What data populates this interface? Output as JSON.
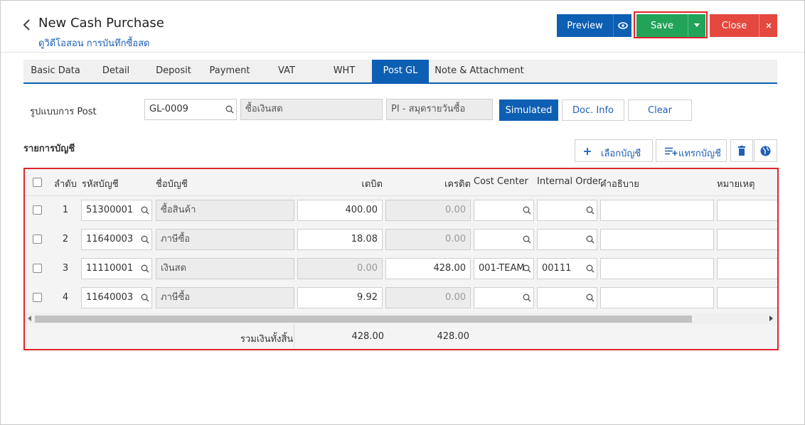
{
  "header": {
    "title": "New Cash Purchase",
    "subtitle": "ดูวิดีโอสอน การบันทึกซื้อสด",
    "preview_label": "Preview",
    "save_label": "Save",
    "close_label": "Close"
  },
  "tabs": [
    {
      "label": "Basic Data"
    },
    {
      "label": "Detail"
    },
    {
      "label": "Deposit"
    },
    {
      "label": "Payment"
    },
    {
      "label": "VAT"
    },
    {
      "label": "WHT"
    },
    {
      "label": "Post GL",
      "active": true
    },
    {
      "label": "Note & Attachment"
    }
  ],
  "post": {
    "label": "รูปแบบการ Post",
    "code": "GL-0009",
    "name": "ซื้อเงินสด",
    "journal": "PI - สมุดรายวันซื้อ",
    "simulated_label": "Simulated",
    "docinfo_label": "Doc. Info",
    "clear_label": "Clear"
  },
  "accounts": {
    "title": "รายการบัญชี",
    "select_label": "เลือกบัญชี",
    "insert_label": "แทรกบัญชี"
  },
  "table": {
    "headers": {
      "seq": "ลำดับ",
      "code": "รหัสบัญชี",
      "name": "ชื่อบัญชี",
      "debit": "เดบิต",
      "credit": "เครดิต",
      "cost_center": "Cost Center",
      "internal_order": "Internal Order",
      "description": "คำอธิบาย",
      "remark": "หมายเหตุ"
    },
    "rows": [
      {
        "no": "1",
        "code": "51300001",
        "name": "ซื้อสินค้า",
        "debit": "400.00",
        "credit": "0.00",
        "cost_center": "",
        "internal_order": "",
        "description": "",
        "remark": ""
      },
      {
        "no": "2",
        "code": "11640003",
        "name": "ภาษีซื้อ",
        "debit": "18.08",
        "credit": "0.00",
        "cost_center": "",
        "internal_order": "",
        "description": "",
        "remark": ""
      },
      {
        "no": "3",
        "code": "11110001",
        "name": "เงินสด",
        "debit": "0.00",
        "credit": "428.00",
        "cost_center": "001-TEAM",
        "internal_order": "00111",
        "description": "",
        "remark": ""
      },
      {
        "no": "4",
        "code": "11640003",
        "name": "ภาษีซื้อ",
        "debit": "9.92",
        "credit": "0.00",
        "cost_center": "",
        "internal_order": "",
        "description": "",
        "remark": ""
      }
    ],
    "footer": {
      "label": "รวมเงินทั้งสิ้น",
      "debit_total": "428.00",
      "credit_total": "428.00"
    }
  },
  "colors": {
    "primary": "#0d5fb3",
    "save": "#21a35a",
    "close": "#e5483e",
    "highlight": "#e0242d"
  }
}
